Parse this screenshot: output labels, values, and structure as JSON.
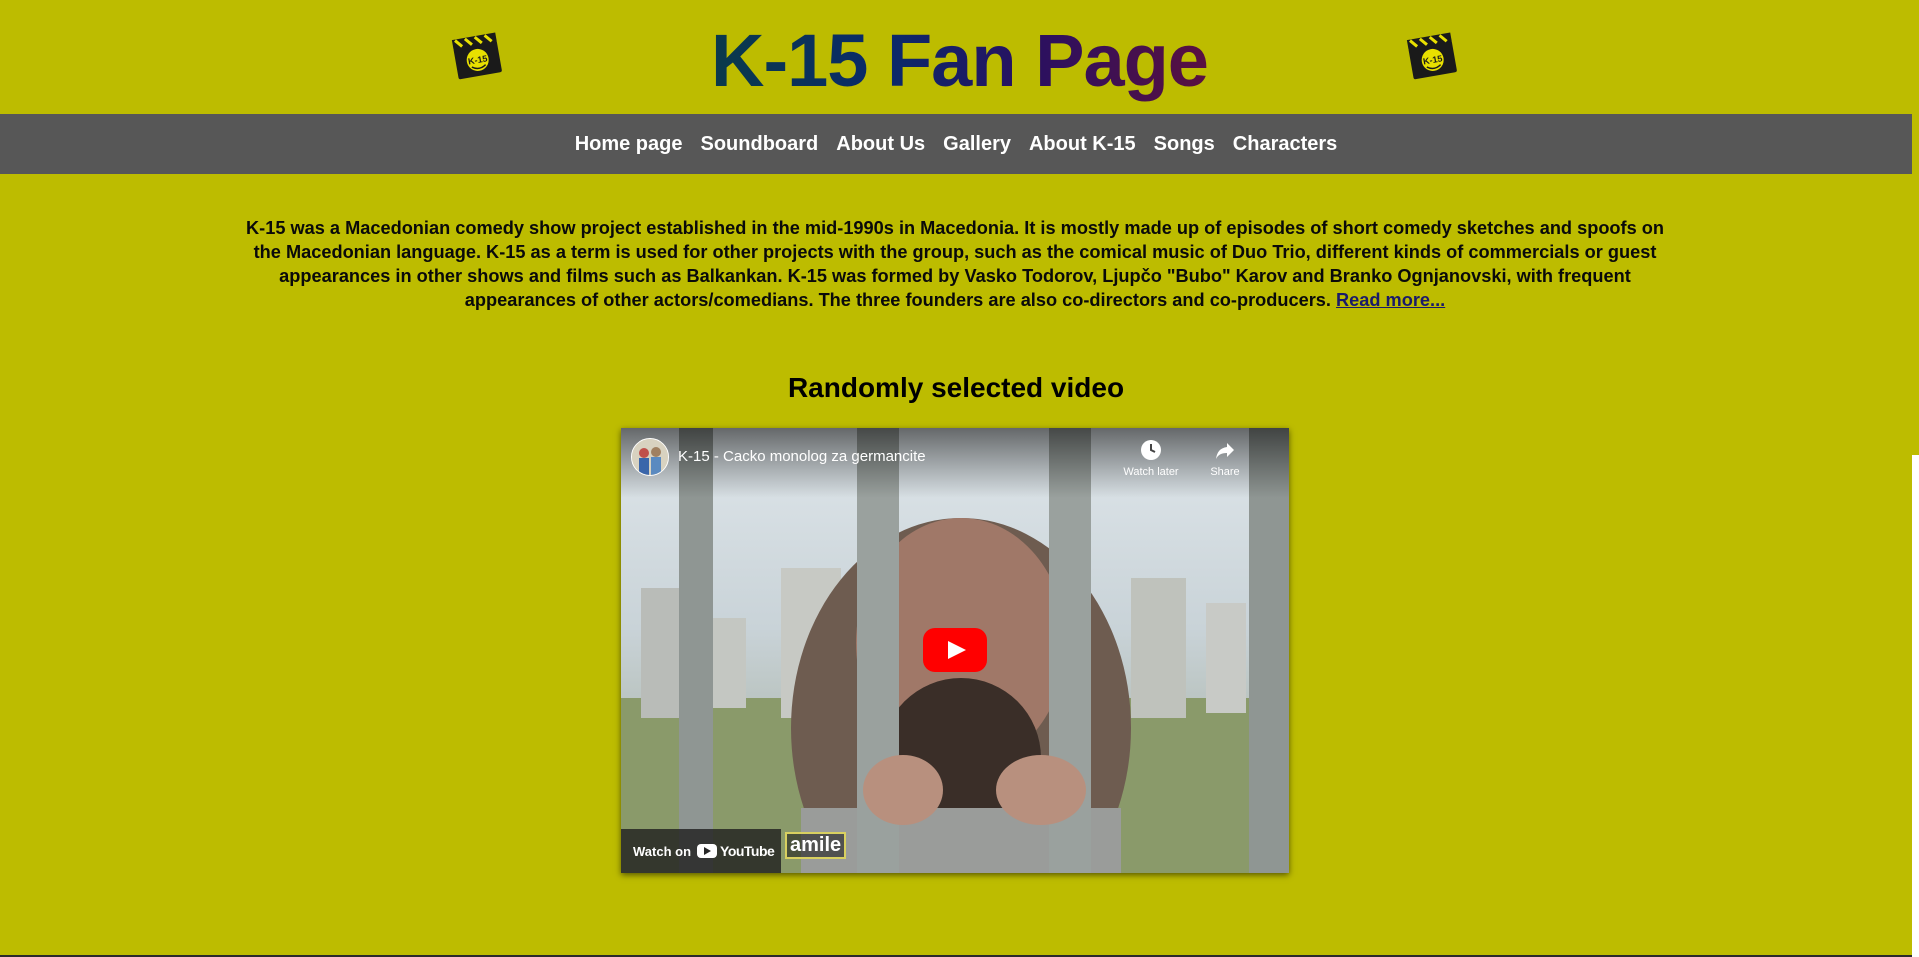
{
  "header": {
    "title": "K-15 Fan Page",
    "logo_left_icon": "clapperboard-k15-logo-icon",
    "logo_right_icon": "clapperboard-k15-logo-icon",
    "logo_text": "K-15"
  },
  "nav": {
    "items": [
      {
        "label": "Home page"
      },
      {
        "label": "Soundboard"
      },
      {
        "label": "About Us"
      },
      {
        "label": "Gallery"
      },
      {
        "label": "About K-15"
      },
      {
        "label": "Songs"
      },
      {
        "label": "Characters"
      }
    ]
  },
  "intro": {
    "text": "K-15 was a Macedonian comedy show project established in the mid-1990s in Macedonia. It is mostly made up of episodes of short comedy sketches and spoofs on the Macedonian language. K-15 as a term is used for other projects with the group, such as the comical music of Duo Trio, different kinds of commercials or guest appearances in other shows and films such as Balkankan. K-15 was formed by Vasko Todorov, Ljupčo \"Bubo\" Karov and Branko Ognjanovski, with frequent appearances of other actors/comedians. The three founders are also co-directors and co-producers.",
    "read_more": "Read more..."
  },
  "video_section": {
    "heading": "Randomly selected video",
    "video_title": "K-15 - Cacko monolog za germancite",
    "watch_later": "Watch later",
    "share": "Share",
    "watch_on": "Watch on",
    "youtube": "YouTube",
    "caption_fragment": "amile"
  },
  "colors": {
    "page_bg": "#bdbc00",
    "nav_bg": "#575757",
    "nav_text": "#ffffff",
    "play_red": "#ff0000"
  }
}
